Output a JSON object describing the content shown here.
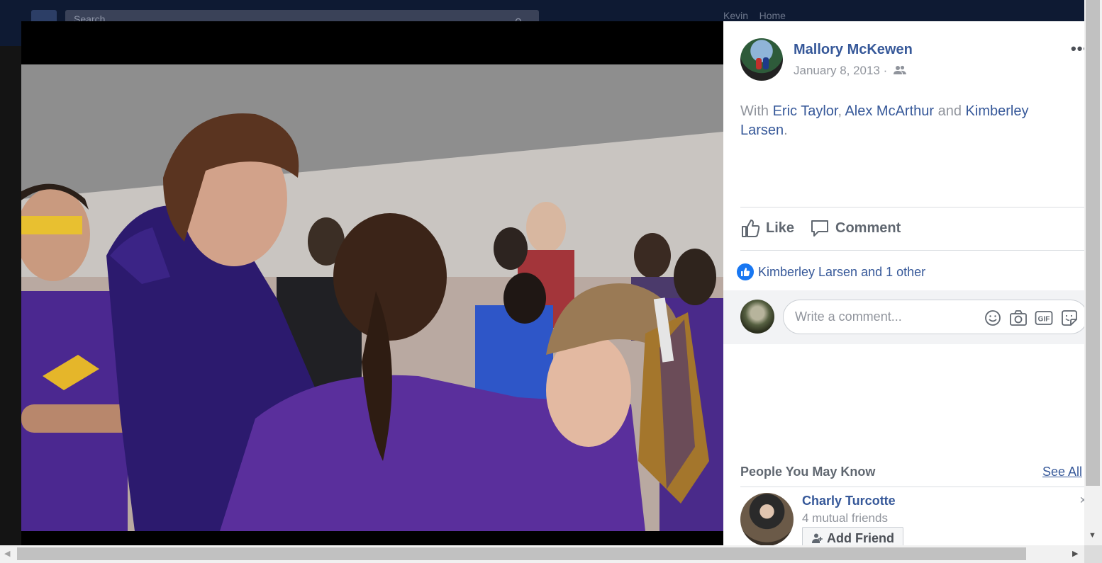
{
  "header": {
    "search_placeholder": "Search",
    "user_name": "Kevin",
    "home_label": "Home"
  },
  "post": {
    "author": "Mallory McKewen",
    "date": "January 8, 2013",
    "date_separator": " · ",
    "privacy_icon": "friends-icon",
    "more_icon": "ellipsis-icon",
    "more_label": "•••",
    "with_prefix": "With ",
    "tagged": [
      "Eric Taylor",
      "Alex McArthur",
      "Kimberley Larsen"
    ],
    "separator_comma": ", ",
    "separator_and": " and ",
    "suffix": "."
  },
  "actions": {
    "like_label": "Like",
    "comment_label": "Comment"
  },
  "reactions": {
    "summary": "Kimberley Larsen and 1 other"
  },
  "comment_box": {
    "placeholder": "Write a comment...",
    "icons": [
      "emoji-icon",
      "camera-icon",
      "gif-icon",
      "sticker-icon"
    ],
    "gif_label": "GIF"
  },
  "people_you_may_know": {
    "title": "People You May Know",
    "see_all": "See All",
    "suggestions": [
      {
        "name": "Charly Turcotte",
        "mutual": "4 mutual friends",
        "button": "Add Friend"
      }
    ]
  },
  "colors": {
    "link": "#365899",
    "muted": "#90949c",
    "like_blue": "#1877f2",
    "purple_team": "#4a1f86"
  }
}
